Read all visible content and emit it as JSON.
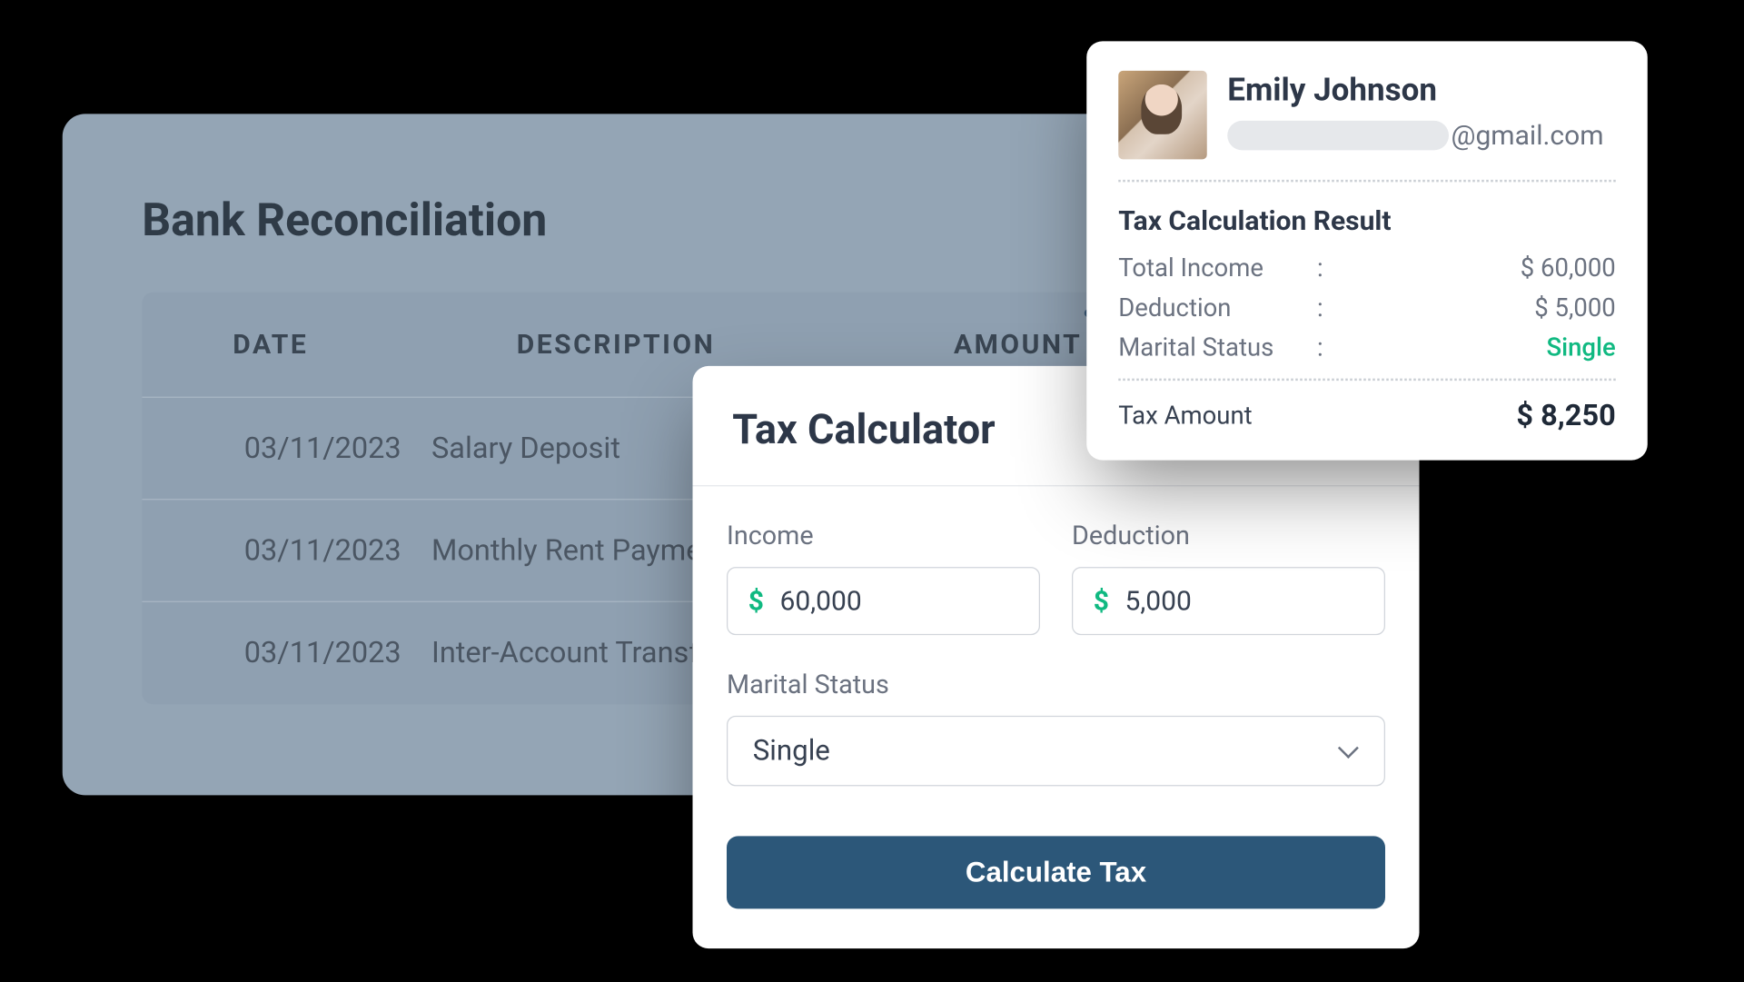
{
  "bank": {
    "title": "Bank Reconciliation",
    "headers": {
      "date": "DATE",
      "description": "DESCRIPTION",
      "amount": "AMOUNT"
    },
    "rows": [
      {
        "date": "03/11/2023",
        "description": "Salary Deposit"
      },
      {
        "date": "03/11/2023",
        "description": "Monthly Rent Payme"
      },
      {
        "date": "03/11/2023",
        "description": "Inter-Account Transf"
      }
    ]
  },
  "calculator": {
    "title": "Tax Calculator",
    "fields": {
      "income_label": "Income",
      "income_value": "60,000",
      "deduction_label": "Deduction",
      "deduction_value": "5,000",
      "marital_label": "Marital Status",
      "marital_value": "Single"
    },
    "currency_symbol": "$",
    "button": "Calculate Tax"
  },
  "profile": {
    "name": "Emily Johnson",
    "email_suffix": "@gmail.com",
    "result_title": "Tax Calculation Result",
    "rows": {
      "income_label": "Total Income",
      "income_value": "$ 60,000",
      "deduction_label": "Deduction",
      "deduction_value": "$ 5,000",
      "status_label": "Marital Status",
      "status_value": "Single"
    },
    "total_label": "Tax Amount",
    "total_value": "$ 8,250",
    "colon": ":"
  }
}
